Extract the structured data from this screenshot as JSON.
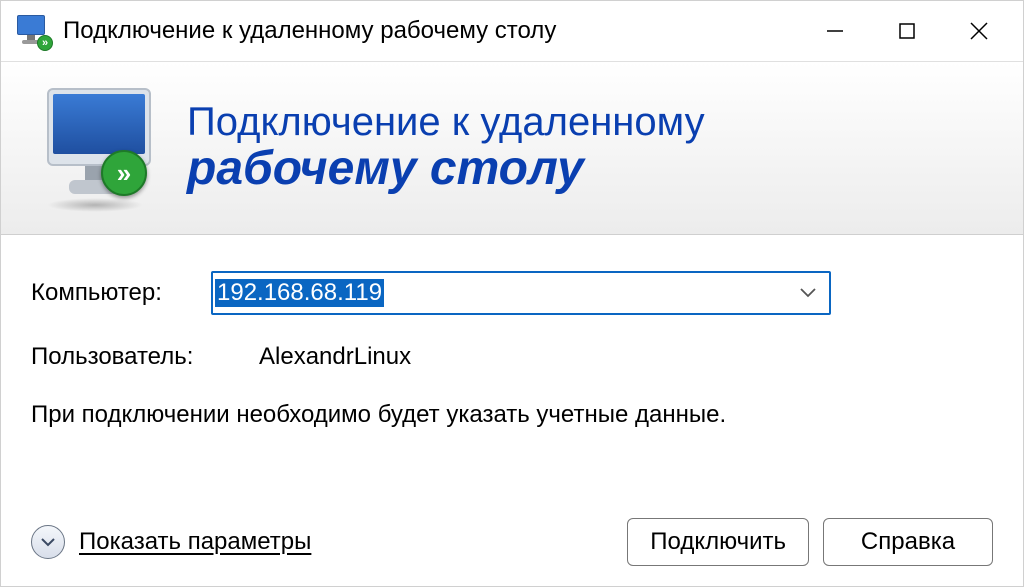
{
  "window": {
    "title": "Подключение к удаленному рабочему столу"
  },
  "banner": {
    "line1": "Подключение к удаленному",
    "line2": "рабочему столу"
  },
  "form": {
    "computer_label": "Компьютер:",
    "computer_value": "192.168.68.119",
    "user_label": "Пользователь:",
    "user_value": "AlexandrLinux",
    "note": "При подключении необходимо будет указать учетные данные."
  },
  "footer": {
    "show_options": "Показать параметры",
    "connect": "Подключить",
    "help": "Справка"
  }
}
